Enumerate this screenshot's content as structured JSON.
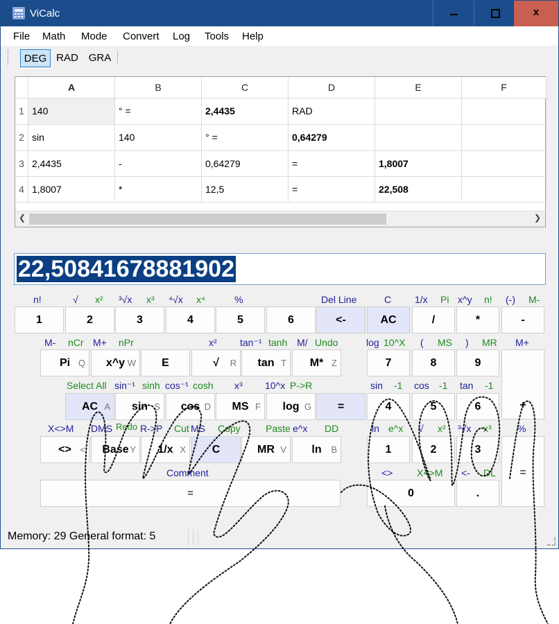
{
  "window": {
    "title": "ViCalc",
    "close_label": "x",
    "accent": "#1b4c8b"
  },
  "menu": [
    "File",
    "Math",
    "Mode",
    "Convert",
    "Log",
    "Tools",
    "Help"
  ],
  "angle_modes": {
    "selected": "DEG",
    "items": [
      "DEG",
      "RAD",
      "GRA"
    ]
  },
  "sheet": {
    "columns": [
      "A",
      "B",
      "C",
      "D",
      "E",
      "F"
    ],
    "rows": [
      {
        "num": "1",
        "cells": [
          "140",
          "° =",
          "2,4435",
          "RAD",
          "",
          ""
        ]
      },
      {
        "num": "2",
        "cells": [
          "sin",
          "140",
          "° =",
          "0,64279",
          "",
          ""
        ]
      },
      {
        "num": "3",
        "cells": [
          "2,4435",
          "-",
          "0,64279",
          "=",
          "1,8007",
          ""
        ]
      },
      {
        "num": "4",
        "cells": [
          "1,8007",
          "*",
          "12,5",
          "=",
          "22,508",
          ""
        ]
      }
    ]
  },
  "display": {
    "value": "22,50841678881902"
  },
  "keys": {
    "n1": "1",
    "n2": "2",
    "n3": "3",
    "n4": "4",
    "n5": "5",
    "n6": "6",
    "backspace": "<-",
    "ac_top": "AC",
    "divide": "/",
    "multiply": "*",
    "minus": "-",
    "pi": "Pi",
    "pi_sub": "Q",
    "xpy": "x^y",
    "xpy_sub": "W",
    "e": "E",
    "sqrt": "√",
    "sqrt_sub": "R",
    "tan": "tan",
    "tan_sub": "T",
    "mstar": "M*",
    "mstar_sub": "Z",
    "p7": "7",
    "p8": "8",
    "p9": "9",
    "plus": "+",
    "ac": "AC",
    "ac_sub": "A",
    "sin": "sin",
    "sin_sub": "S",
    "cos": "cos",
    "cos_sub": "D",
    "ms": "MS",
    "ms_sub": "F",
    "log": "log",
    "log_sub": "G",
    "equals_mid": "=",
    "p4": "4",
    "p5": "5",
    "p6": "6",
    "swap": "<>",
    "swap_sub": "<",
    "base": "Base",
    "base_sub": "Y",
    "inv": "1/x",
    "inv_sub": "X",
    "clear": "C",
    "mr": "MR",
    "mr_sub": "V",
    "ln": "ln",
    "ln_sub": "B",
    "p1": "1",
    "p2": "2",
    "p3": "3",
    "wide_equals": "=",
    "p0": "0",
    "dot": ".",
    "eq_big": "="
  },
  "hints": {
    "r1": [
      "n!",
      "√",
      "x²",
      "³√x",
      "x³",
      "⁴√x",
      "x⁴",
      "%",
      "Del Line",
      "C",
      "1/x",
      "Pi",
      "x^y",
      "n!",
      "(-)",
      "M-"
    ],
    "r2": [
      "M-",
      "nCr",
      "M+",
      "nPr",
      "x²",
      "tan⁻¹",
      "tanh",
      "M/",
      "Undo",
      "log",
      "10^X",
      "(",
      "MS",
      ")",
      "MR",
      "M+"
    ],
    "r3": [
      "Select All",
      "sin⁻¹",
      "sinh",
      "cos⁻¹",
      "cosh",
      "x³",
      "10^x",
      "P->R",
      "sin",
      "-1",
      "cos",
      "-1",
      "tan",
      "-1"
    ],
    "r4": [
      "X<>M",
      "DMS",
      "Redo",
      "R->P",
      "Cut",
      "MS",
      "Copy",
      "Paste",
      "e^x",
      "DD",
      "ln",
      "e^x",
      "√",
      "x²",
      "³√x",
      "x³",
      "%"
    ],
    "r5": [
      "Comment",
      "<>",
      "X<>M",
      "<-",
      "DL"
    ]
  },
  "status": {
    "text": "Memory: 29  General format: 5"
  },
  "colors": {
    "hint_navy": "#1c1d9a",
    "hint_green": "#1d8a1d",
    "display_bg": "#0a3f83",
    "blue_key": "#e2e6f8"
  }
}
